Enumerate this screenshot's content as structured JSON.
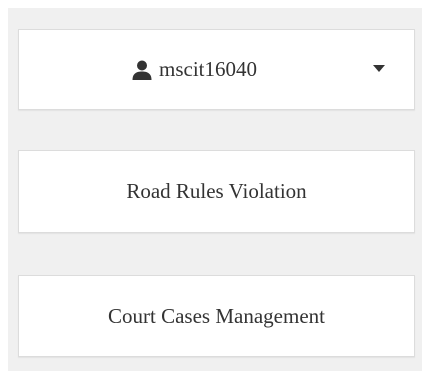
{
  "user_menu": {
    "username": "mscit16040",
    "icon": "user-icon",
    "dropdown_icon": "caret-down-icon"
  },
  "menu": {
    "items": [
      {
        "label": "Road Rules Violation"
      },
      {
        "label": "Court Cases Management"
      }
    ]
  },
  "colors": {
    "background": "#f0f0f0",
    "card": "#ffffff",
    "text": "#333333"
  }
}
